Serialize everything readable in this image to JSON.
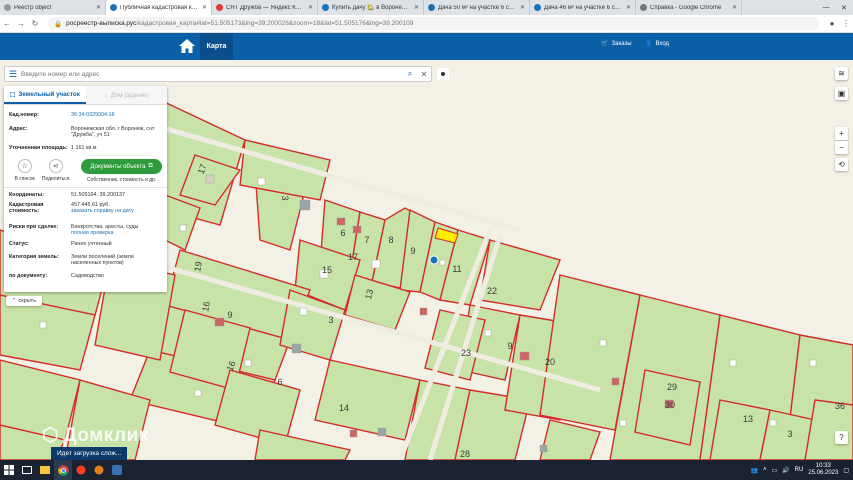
{
  "browser": {
    "tabs": [
      {
        "label": "Реестр object",
        "color": "#999"
      },
      {
        "label": "Публичная кадастровая ка...",
        "color": "#1a73b8",
        "active": true
      },
      {
        "label": "СНТ Дружба — Яндекс Карт...",
        "color": "#e53935"
      },
      {
        "label": "Купить дачу 🏡 в Воронеже...",
        "color": "#1a73b8"
      },
      {
        "label": "Дача 50 м² на участке 6 сот...",
        "color": "#1a73b8"
      },
      {
        "label": "Дача 46 м² на участке 6 сот...",
        "color": "#1a73b8"
      },
      {
        "label": "Справка - Google Chrome",
        "color": "#777"
      }
    ],
    "address": {
      "host": "росреестр-выписка.рус",
      "rest": "/кадастровая_карта#lat=51.505173&lng=39.200028&zoom=18&lat=51.505176&lng=39.200109"
    }
  },
  "header": {
    "map_tab": "Карта",
    "cart": "Заказы",
    "login": "Вход"
  },
  "search": {
    "placeholder": "Введите номер или адрес"
  },
  "panel": {
    "tab_active": "Земельный участок",
    "tab_inactive": "Дом (здание)",
    "rows": [
      {
        "k": "Кад.номер:",
        "v": "36:34:0329004:18"
      },
      {
        "k": "Адрес:",
        "v": "Воронежская обл, г Воронеж, снт \"Дружба\", уч 51"
      },
      {
        "k": "Уточненная площадь:",
        "v": "1 161 кв.м"
      }
    ],
    "act_fav": "В список",
    "act_share": "Поделиться",
    "doc_button": "Документы объекта",
    "doc_sub": "Собственник, стоимость и др.",
    "coords_k": "Координаты:",
    "coords_v": "51.505164, 39.200137",
    "cost_k": "Кадастровая стоимость:",
    "cost_v": "457 445.61 руб.",
    "cost_link": "заказать справку на дату",
    "risk_k": "Риски при сделке:",
    "risk_v": "Банкротства, аресты, суды",
    "risk_link": "полная проверка",
    "status_k": "Статус:",
    "status_v": "Ранее учтенный",
    "cat_k": "Категория земель:",
    "cat_v": "Земли поселений (земли населенных пунктов)",
    "doc_k": "по документу:",
    "doc_v": "Садоводство",
    "collapse": "скрыть"
  },
  "watermark": "Домклик",
  "map_labels": [
    "3",
    "6",
    "7",
    "8",
    "9",
    "11",
    "15",
    "17",
    "13",
    "19",
    "16",
    "9",
    "3",
    "22",
    "23",
    "9",
    "20",
    "14",
    "6",
    "16",
    "28",
    "29",
    "30",
    "13",
    "36",
    "3",
    "17"
  ],
  "taskbar": {
    "toast": "Идет загрузка слож...",
    "lang": "RU",
    "time": "10:33",
    "date": "25.06.2023"
  },
  "colors": {
    "brand": "#0b5fa6",
    "parcel_fill": "#c7e3a7",
    "parcel_border": "#d52b2b",
    "highlight": "#ffeb00",
    "green_btn": "#2e9c3c"
  }
}
